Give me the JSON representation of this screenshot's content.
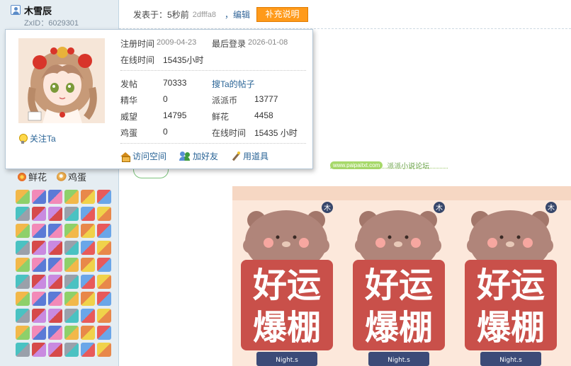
{
  "user": {
    "name": "木雪辰",
    "zxid": "ZxID：6029301"
  },
  "post": {
    "posted_prefix": "发表于：",
    "posted_time": "5秒前",
    "hash": "2dfffa8",
    "edit": "，编辑",
    "add_button": "补充说明"
  },
  "profile": {
    "register_label": "注册时间",
    "register_value": "2009-04-23",
    "lastlogin_label": "最后登录",
    "lastlogin_value": "2026-01-08",
    "online_label": "在线时间",
    "online_value": "15435小时",
    "follow": "关注Ta",
    "stats": {
      "posts_label": "发帖",
      "posts_value": "70333",
      "search_link": "搜Ta的帖子",
      "digest_label": "精华",
      "digest_value": "0",
      "coins_label": "派派币",
      "coins_value": "13777",
      "prestige_label": "威望",
      "prestige_value": "14795",
      "flowers_label": "鲜花",
      "flowers_value": "4458",
      "eggs_label": "鸡蛋",
      "eggs_value": "0",
      "online2_label": "在线时间",
      "online2_value": "15435 小时"
    },
    "actions": {
      "visit": "访问空间",
      "add_friend": "加好友",
      "use_item": "用道具"
    }
  },
  "sidebar": {
    "flower_label": "鲜花",
    "egg_label": "鸡蛋"
  },
  "site": {
    "url": "www.paipaitxt.com",
    "name": "派派小说论坛"
  },
  "image_text": {
    "word1": "好运",
    "word2": "爆棚",
    "badge": "木",
    "footer": "Night.s"
  },
  "colors": {
    "accent_orange": "#ff9a1a",
    "link_blue": "#2a6496",
    "sidebar_bg": "#e5edf2",
    "card_red": "#c9504a"
  }
}
